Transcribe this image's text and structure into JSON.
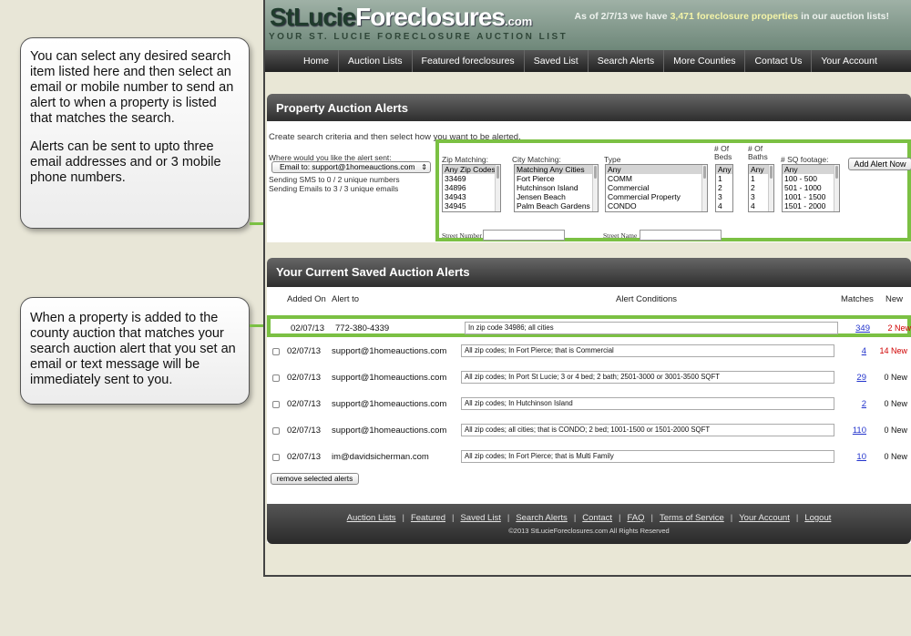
{
  "callouts": {
    "criteria_p1": "You can select any desired search item listed here and then select an email or mobile number to send an alert to when a property is listed that matches the search.",
    "criteria_p2": "Alerts can be sent to upto three email addresses and or 3 mobile phone numbers.",
    "new_property": "When a property is added to the county auction that matches your search auction alert that you set an email or text message will be immediately sent to you."
  },
  "header": {
    "logo_st": "StLucie",
    "logo_main": "Foreclosures",
    "logo_com": ".com",
    "tagline": "YOUR ST. LUCIE FORECLOSURE AUCTION LIST",
    "stats_prefix": "As of 2/7/13 we have",
    "stats_count": "3,471 foreclosure properties",
    "stats_suffix": "in our auction lists!"
  },
  "nav": [
    "Home",
    "Auction Lists",
    "Featured foreclosures",
    "Saved List",
    "Search Alerts",
    "More Counties",
    "Contact Us",
    "Your Account"
  ],
  "alerts_panel": {
    "title": "Property Auction Alerts",
    "instructions": "Create search criteria and then select how you want to be alerted.",
    "send_label": "Where would you like the alert sent:",
    "send_value": "Email to: support@1homeauctions.com",
    "sms_info": "Sending SMS to 0 / 2 unique numbers",
    "email_info": "Sending Emails to 3 / 3 unique emails",
    "zip_label": "Zip Matching:",
    "zip_options": [
      "Any Zip Codes",
      "33469",
      "34896",
      "34943",
      "34945"
    ],
    "city_label": "City Matching:",
    "city_options": [
      "Matching Any Cities",
      "Fort Pierce",
      "Hutchinson Island",
      "Jensen Beach",
      "Palm Beach Gardens"
    ],
    "type_label": "Type",
    "type_options": [
      "Any",
      "COMM",
      "Commercial",
      "Commercial Property",
      "CONDO"
    ],
    "beds_label_1": "# Of",
    "beds_label_2": "Beds",
    "beds_options": [
      "Any",
      "1",
      "2",
      "3",
      "4"
    ],
    "baths_label_1": "# Of",
    "baths_label_2": "Baths",
    "baths_options": [
      "Any",
      "1",
      "2",
      "3",
      "4"
    ],
    "sqft_label": "# SQ footage:",
    "sqft_options": [
      "Any",
      "100 - 500",
      "501 - 1000",
      "1001 - 1500",
      "1501 - 2000"
    ],
    "add_button": "Add Alert Now",
    "street_number_label": "Street Number",
    "street_name_label": "Street Name"
  },
  "saved_panel": {
    "title": "Your Current Saved Auction Alerts",
    "col_added": "Added On",
    "col_to": "Alert to",
    "col_conditions": "Alert Conditions",
    "col_matches": "Matches",
    "col_new": "New",
    "rows": [
      {
        "date": "02/07/13",
        "to": "772-380-4339",
        "conditions": "In zip code 34986; all cities",
        "matches": "349",
        "new": "2 New"
      },
      {
        "date": "02/07/13",
        "to": "support@1homeauctions.com",
        "conditions": "All zip codes; In Fort Pierce; that is Commercial",
        "matches": "4",
        "new": "14 New"
      },
      {
        "date": "02/07/13",
        "to": "support@1homeauctions.com",
        "conditions": "All zip codes; In Port St Lucie; 3 or 4 bed; 2 bath; 2501-3000 or 3001-3500 SQFT",
        "matches": "29",
        "new": "0 New"
      },
      {
        "date": "02/07/13",
        "to": "support@1homeauctions.com",
        "conditions": "All zip codes; In Hutchinson Island",
        "matches": "2",
        "new": "0 New"
      },
      {
        "date": "02/07/13",
        "to": "support@1homeauctions.com",
        "conditions": "All zip codes; all cities; that is CONDO; 2 bed; 1001-1500 or 1501-2000 SQFT",
        "matches": "110",
        "new": "0 New"
      },
      {
        "date": "02/07/13",
        "to": "im@davidsicherman.com",
        "conditions": "All zip codes; In Fort Pierce; that is Multi Family",
        "matches": "10",
        "new": "0 New"
      }
    ],
    "remove_button": "remove selected alerts"
  },
  "footer": {
    "links": [
      "Auction Lists",
      "Featured",
      "Saved List",
      "Search Alerts",
      "Contact",
      "FAQ",
      "Terms of Service",
      "Your Account",
      "Logout"
    ],
    "copyright": "©2013 StLucieForeclosures.com All Rights Reserved"
  },
  "colors": {
    "highlight": "#7bc043",
    "new_red": "#d00000",
    "link": "#2233cc"
  }
}
